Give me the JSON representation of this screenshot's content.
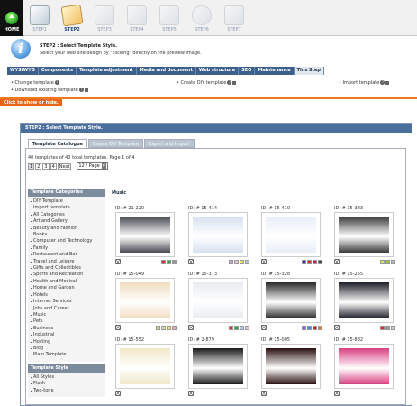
{
  "header": {
    "home_label": "HOME",
    "steps": [
      "STEP1",
      "STEP2",
      "STEP3",
      "STEP4",
      "STEP5",
      "STEP6",
      "STEP7"
    ]
  },
  "intro": {
    "title": "STEP2 : Select Template Style.",
    "desc": "Select your web site design by \"clicking\" directly on the preview image."
  },
  "menu": [
    "WYSIWYG",
    "Components",
    "Template adjustment",
    "Media and document",
    "Web structure",
    "SEO",
    "Maintenance",
    "This Step"
  ],
  "links": {
    "change": "Change template",
    "download": "Download existing template",
    "create_diy": "Create DIY template",
    "import": "Import template"
  },
  "toggle_label": "Click to show or hide.",
  "panel": {
    "title": "STEP2 : Select Template Style.",
    "tabs": [
      "Template Catalogue",
      "Create DIY Template",
      "Export and Import"
    ]
  },
  "catalogue": {
    "count_text": "40 templates of 40 total templates. Page 1 of 4",
    "pages": [
      "1",
      "2",
      "3",
      "4"
    ],
    "next": "Next",
    "per_page": "12 / Page"
  },
  "sidebar": {
    "categories_title": "Template Categories",
    "categories": [
      "DIY Template",
      "Import template",
      "All Categories",
      "Art and Gallery",
      "Beauty and Fashion",
      "Books",
      "Computer and Technology",
      "Family",
      "Restaurant and Bar",
      "Travel and Leisure",
      "Gifts and Collectibles",
      "Sports and Recreation",
      "Health and Medical",
      "Home and Garden",
      "Hotels",
      "Internet Services",
      "Jobs and Career",
      "Music",
      "Pets",
      "Business",
      "Industrial",
      "Hosting",
      "Blog",
      "Plain Template"
    ],
    "style_title": "Template Style",
    "styles": [
      "All Styles",
      "Flash",
      "Two-tone"
    ]
  },
  "main": {
    "heading": "Music",
    "templates": [
      {
        "id": "ID: # 21-220",
        "swatches": [
          "#e0282c",
          "#2fa63c",
          "#999999"
        ],
        "bg": "#4a4a55"
      },
      {
        "id": "ID: # 15-414",
        "swatches": [
          "#c8a0e8",
          "#f0c8dc",
          "#e8e06a",
          "#b0c8e8"
        ],
        "bg": "#d7e0f0"
      },
      {
        "id": "ID: # 15-410",
        "swatches": [
          "#2030c0",
          "#e02828",
          "#c02060",
          "#444444"
        ],
        "bg": "#e8eef8"
      },
      {
        "id": "ID: # 15-383",
        "swatches": [
          "#d8e060",
          "#8ad030",
          "#bbbbbb"
        ],
        "bg": "#3a3a3a"
      },
      {
        "id": "ID: # 15-049",
        "swatches": [
          "#b8e080",
          "#c8e8a0",
          "#f0e070",
          "#f0a0c0"
        ],
        "bg": "#f0dcc0"
      },
      {
        "id": "ID: # 15-373",
        "swatches": [
          "#e02828",
          "#2fa63c",
          "#b0c8e8",
          "#f0c0d0"
        ],
        "bg": "#e8ecf0"
      },
      {
        "id": "ID: # 15-328",
        "swatches": [
          "#8060e0",
          "#3090e0",
          "#c02828",
          "#e08030"
        ],
        "bg": "#2a2a2a"
      },
      {
        "id": "ID: # 15-255",
        "swatches": [
          "#e02828",
          "#8a9aa8",
          "#cccccc"
        ],
        "bg": "#1e1e28"
      },
      {
        "id": "ID: # 15-552",
        "swatches": [],
        "bg": "#f0e8c8"
      },
      {
        "id": "ID: # 2-879",
        "swatches": [],
        "bg": "#1a1a1a"
      },
      {
        "id": "ID: # 15-005",
        "swatches": [],
        "bg": "#2a1010"
      },
      {
        "id": "ID: # 15-882",
        "swatches": [],
        "bg": "#d84080"
      }
    ]
  }
}
